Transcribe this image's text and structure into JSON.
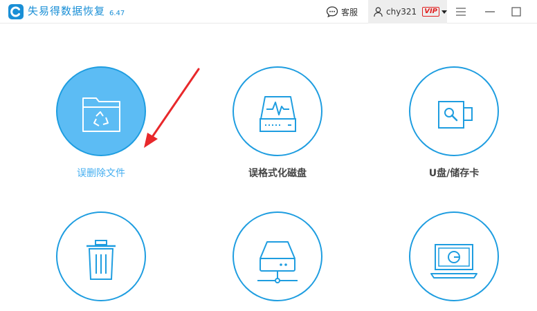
{
  "app": {
    "title": "失易得数据恢复",
    "version": "6.47"
  },
  "header": {
    "support_label": "客服",
    "username": "chy321",
    "vip_label": "VIP"
  },
  "features": [
    {
      "label": "误删除文件",
      "icon": "folder-recycle-icon",
      "selected": true
    },
    {
      "label": "误格式化磁盘",
      "icon": "disk-pulse-icon",
      "selected": false
    },
    {
      "label": "U盘/储存卡",
      "icon": "usb-drive-icon",
      "selected": false
    },
    {
      "label": "",
      "icon": "trash-bin-icon",
      "selected": false
    },
    {
      "label": "",
      "icon": "network-disk-icon",
      "selected": false
    },
    {
      "label": "",
      "icon": "laptop-icon",
      "selected": false
    }
  ],
  "colors": {
    "brand": "#1a8fd6",
    "accent": "#1e9de0",
    "selected_fill": "#5cbcf4",
    "arrow": "#e8282b"
  }
}
